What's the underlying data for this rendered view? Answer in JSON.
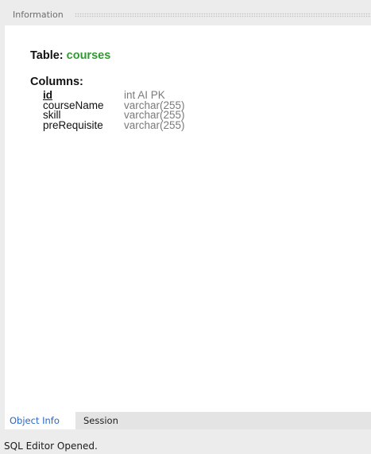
{
  "panel": {
    "title": "Information"
  },
  "info": {
    "table_label": "Table:",
    "table_name": "courses",
    "columns_label": "Columns:",
    "columns": [
      {
        "name": "id",
        "type": "int AI PK"
      },
      {
        "name": "courseName",
        "type": "varchar(255)"
      },
      {
        "name": "skill",
        "type": "varchar(255)"
      },
      {
        "name": "preRequisite",
        "type": "varchar(255)"
      }
    ]
  },
  "tabs": [
    {
      "label": "Object Info",
      "active": true
    },
    {
      "label": "Session",
      "active": false
    }
  ],
  "status": {
    "text": "SQL Editor Opened."
  },
  "colors": {
    "table_name": "#2f9a2f",
    "active_tab": "#2a66c8"
  }
}
